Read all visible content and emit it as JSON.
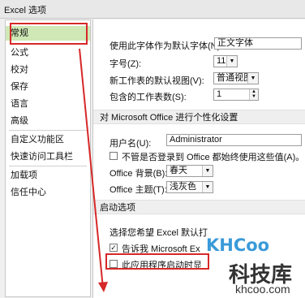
{
  "window": {
    "title": "Excel 选项"
  },
  "sidebar": {
    "items": [
      {
        "label": "常规"
      },
      {
        "label": "公式"
      },
      {
        "label": "校对"
      },
      {
        "label": "保存"
      },
      {
        "label": "语言"
      },
      {
        "label": "高级"
      },
      {
        "label": "自定义功能区"
      },
      {
        "label": "快速访问工具栏"
      },
      {
        "label": "加载项"
      },
      {
        "label": "信任中心"
      }
    ]
  },
  "general": {
    "font_label": "使用此字体作为默认字体(N):",
    "font_value": "正文字体",
    "size_label": "字号(Z):",
    "size_value": "11",
    "view_label": "新工作表的默认视图(V):",
    "view_value": "普通视图",
    "sheets_label": "包含的工作表数(S):",
    "sheets_value": "1"
  },
  "personalize": {
    "header": "对 Microsoft Office 进行个性化设置",
    "username_label": "用户名(U):",
    "username_value": "Administrator",
    "always_use_label": "不管是否登录到 Office 都始终使用这些值(A)。",
    "background_label": "Office 背景(B):",
    "background_value": "春天",
    "theme_label": "Office 主题(T):",
    "theme_value": "浅灰色"
  },
  "startup": {
    "header": "启动选项",
    "choose_label": "选择您希望 Excel 默认打",
    "tell_label": "告诉我 Microsoft Ex",
    "show_label": "此应用程序启动时显"
  },
  "watermark": {
    "brand": "KHCoo",
    "name": "科技库",
    "url": "khcoo.com"
  },
  "colors": {
    "selected": "#cfe8b5",
    "annotation": "#d62828"
  }
}
